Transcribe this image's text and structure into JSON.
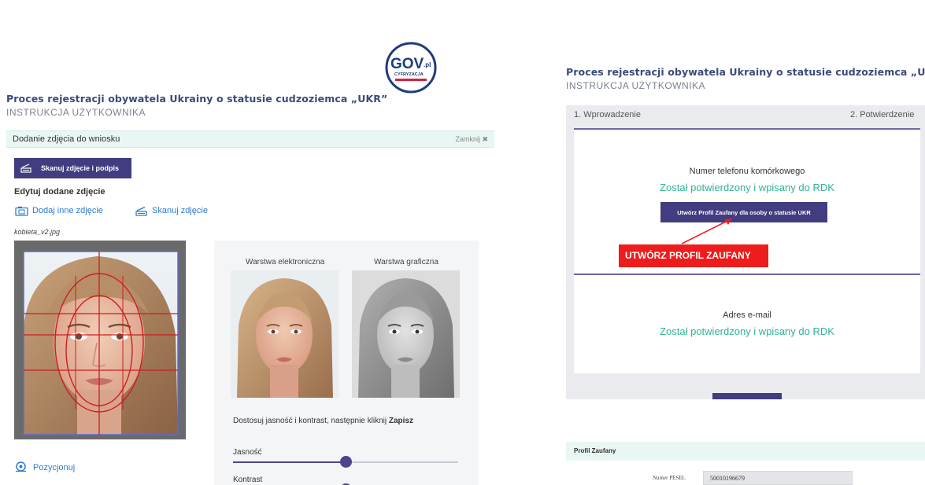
{
  "logo": {
    "text": "GOV",
    "suffix": ".pl",
    "subtitle": "CYFRYZACJA",
    "icon": "gov-pl-logo-icon"
  },
  "left": {
    "title": "Proces rejestracji obywatela Ukrainy o statusie cudzoziemca „UKR”",
    "subtitle": "INSTRUKCJA UŻYTKOWNIKA",
    "section_bar": {
      "label": "Dodanie zdjęcia do wniosku",
      "close_label": "Zamknij ✖"
    },
    "scan_button": {
      "label": "Skanuj zdjęcie i podpis",
      "icon": "scanner-icon"
    },
    "edit_heading": "Edytuj dodane zdjęcie",
    "links": [
      {
        "label": "Dodaj inne zdjęcie",
        "icon": "camera-icon"
      },
      {
        "label": "Skanuj zdjęcie",
        "icon": "scanner-icon"
      }
    ],
    "file_name": "kobieta_v2.jpg",
    "layers": {
      "electronic_label": "Warstwa elektroniczna",
      "graphic_label": "Warstwa graficzna"
    },
    "adjust_text": "Dostosuj jasność i kontrast, następnie kliknij",
    "adjust_text_bold": "Zapisz",
    "sliders": [
      {
        "label": "Jasność",
        "value": 0.5
      },
      {
        "label": "Kontrast",
        "value": 0.5
      }
    ],
    "position_link": {
      "label": "Pozycjonuj",
      "icon": "target-icon"
    }
  },
  "right": {
    "title": "Proces rejestracji obywatela Ukrainy o statusie cudzoziemca „UKR”",
    "subtitle": "INSTRUKCJA UŻYTKOWNIKA",
    "steps": [
      "1. Wprowadzenie",
      "2. Potwierdzenie"
    ],
    "phone_card": {
      "label": "Numer telefonu komórkowego",
      "status": "Został potwierdzony i wpisany do RDK",
      "button_label": "Utwórz Profil Zaufany dla osoby o statusie UKR"
    },
    "callout": "UTWÓRZ PROFIL ZAUFANY",
    "email_card": {
      "label": "Adres e-mail",
      "status": "Został potwierdzony i wpisany do RDK"
    },
    "profile_bar": "Profil Zaufany",
    "pesel": {
      "label": "Numer PESEL",
      "value": "50010196679"
    }
  },
  "colors": {
    "brand": "#423c80",
    "success": "#2eb391",
    "alert": "#ee1c1c",
    "title": "#3a4a7a",
    "link": "#2a7bd0"
  }
}
